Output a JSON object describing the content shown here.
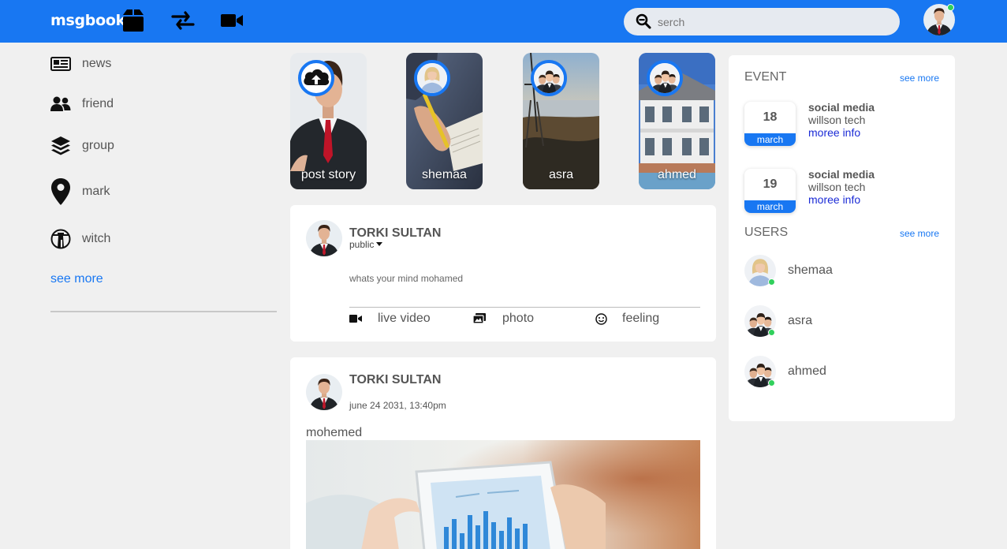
{
  "app": {
    "name": "msgbook"
  },
  "colors": {
    "brand": "#1877f2",
    "background": "#f0f0f0",
    "online": "#31d05c",
    "link": "#1b2bd6"
  },
  "topbar": {
    "icons": [
      "box-icon",
      "swap-arrows-icon",
      "video-camera-icon"
    ],
    "search_placeholder": "serch"
  },
  "sidebar": {
    "items": [
      {
        "label": "news",
        "icon": "newspaper-icon"
      },
      {
        "label": "friend",
        "icon": "users-icon"
      },
      {
        "label": "group",
        "icon": "layers-icon"
      },
      {
        "label": "mark",
        "icon": "map-marker-icon"
      },
      {
        "label": "witch",
        "icon": "lighthouse-icon"
      }
    ],
    "see_more": "see more"
  },
  "stories": [
    {
      "label": "post story",
      "icon": "cloud-upload-icon"
    },
    {
      "label": "shemaa"
    },
    {
      "label": "asra"
    },
    {
      "label": "ahmed"
    }
  ],
  "composer": {
    "author": "TORKI SULTAN",
    "audience": "public",
    "placeholder": "whats your mind mohamed",
    "actions": [
      {
        "label": "live video",
        "icon": "video-camera-icon"
      },
      {
        "label": "photo",
        "icon": "photos-icon"
      },
      {
        "label": "feeling",
        "icon": "smile-icon"
      }
    ]
  },
  "post": {
    "author": "TORKI SULTAN",
    "timestamp": "june 24 2031, 13:40pm",
    "text": "mohemed"
  },
  "events": {
    "title": "EVENT",
    "see_more": "see more",
    "items": [
      {
        "day": "18",
        "month": "march",
        "title": "social media",
        "org": "willson tech",
        "link": "moree info"
      },
      {
        "day": "19",
        "month": "march",
        "title": "social media",
        "org": "willson tech",
        "link": "moree info"
      }
    ]
  },
  "users": {
    "title": "USERS",
    "see_more": "see more",
    "items": [
      {
        "name": "shemaa",
        "online": true
      },
      {
        "name": "asra",
        "online": true
      },
      {
        "name": "ahmed",
        "online": true
      }
    ]
  }
}
